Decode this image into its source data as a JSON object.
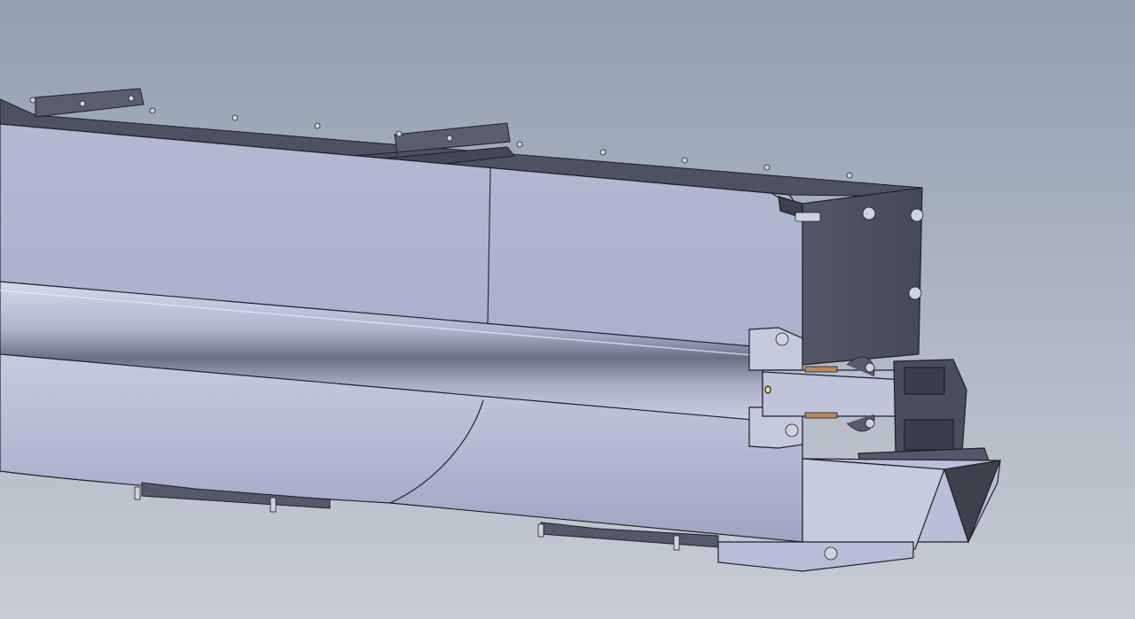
{
  "viewport": {
    "background_top": "#93a0b0",
    "background_bottom": "#c7ccd4"
  },
  "model": {
    "colors": {
      "steel_light": "#b8bed8",
      "steel_mid": "#a9b0cc",
      "steel_dark": "#4e5160",
      "steel_darker": "#3e404b",
      "edge": "#1e2028",
      "highlight": "#dfe3f4",
      "fastener": "#cfd3dc",
      "bronze": "#b8875a",
      "accent_yellow": "#e8e070"
    }
  }
}
